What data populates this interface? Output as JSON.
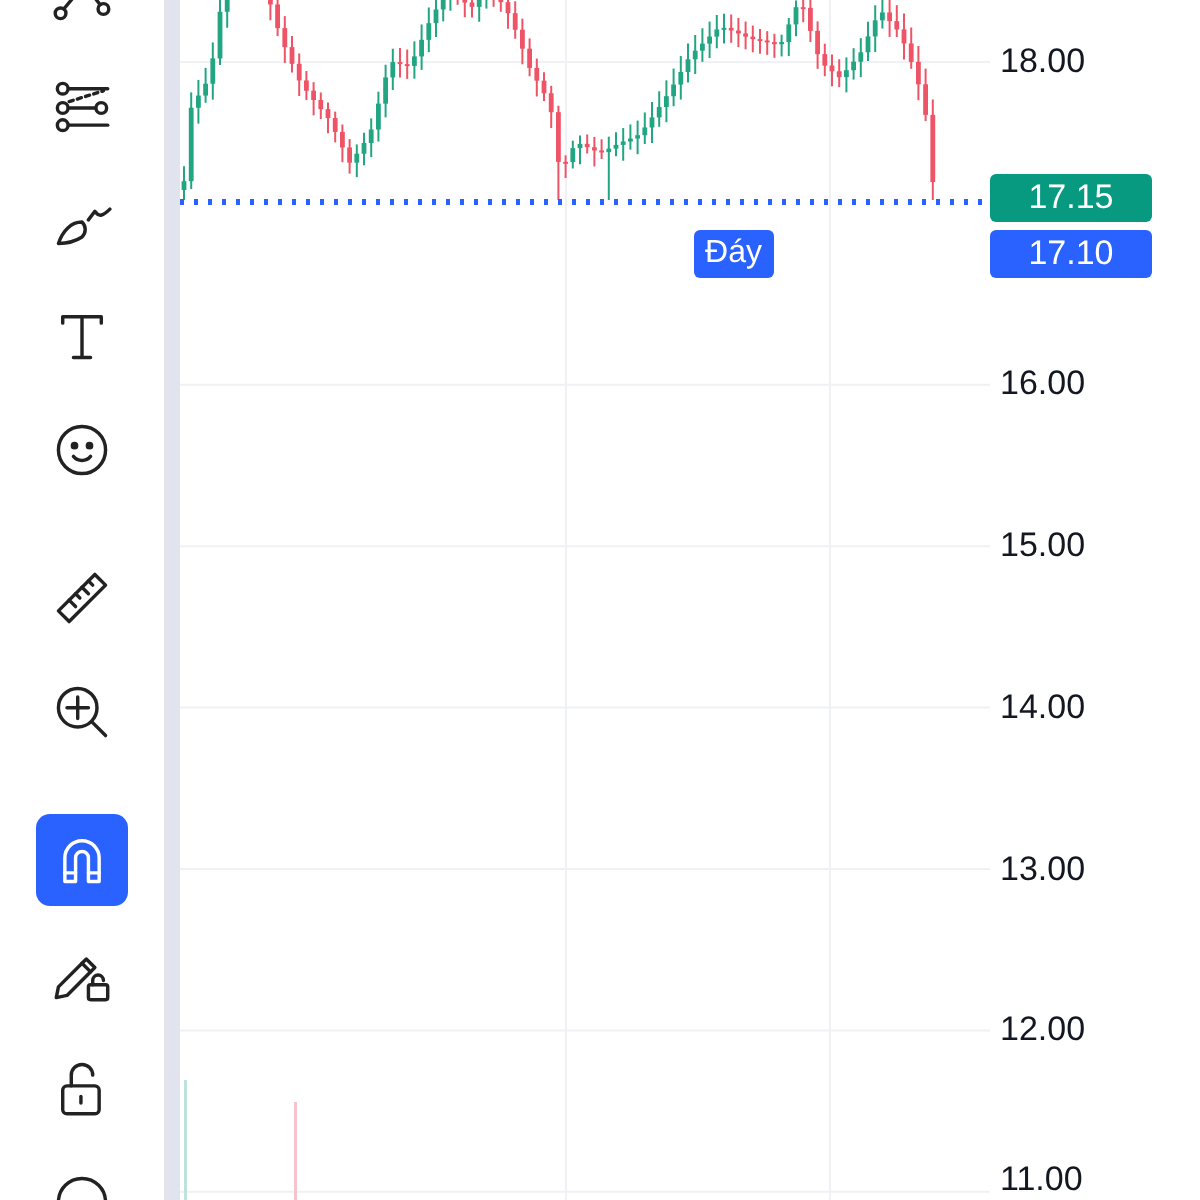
{
  "toolbar": {
    "groups": [
      [
        {
          "kind": "nodes",
          "selected": false
        },
        {
          "kind": "lines",
          "selected": false
        },
        {
          "kind": "brush",
          "selected": false
        },
        {
          "kind": "text",
          "selected": false
        },
        {
          "kind": "emoji",
          "selected": false
        }
      ],
      [
        {
          "kind": "ruler",
          "selected": false
        },
        {
          "kind": "zoom",
          "selected": false
        }
      ],
      [
        {
          "kind": "magnet",
          "selected": true
        },
        {
          "kind": "pencil-lock",
          "selected": false
        },
        {
          "kind": "lock",
          "selected": false
        },
        {
          "kind": "eye",
          "selected": false
        }
      ]
    ]
  },
  "price_axis": {
    "labels": [
      "18.00",
      "16.00",
      "15.00",
      "14.00",
      "13.00",
      "12.00",
      "11.00"
    ],
    "last_price": {
      "value": "17.15",
      "color": "#089981"
    },
    "low_marker": {
      "label": "Đáy",
      "value": "17.10",
      "color": "#2962ff"
    }
  }
}
